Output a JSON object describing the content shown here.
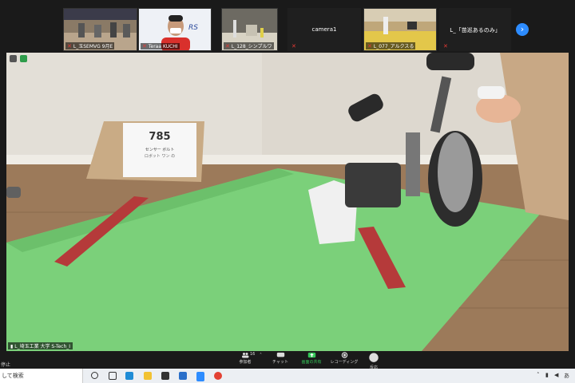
{
  "gallery": {
    "participants": [
      {
        "label": "L_玉SEMVG 9月E",
        "muted": true
      },
      {
        "label": "Teraa KUCHI",
        "muted": true
      },
      {
        "label": "L_128_シンプルワ",
        "muted": true
      },
      {
        "label": "camera1",
        "muted": true
      },
      {
        "label": "L_077_アルクスる",
        "muted": true
      },
      {
        "label": "L_「苗巡あるのみ」",
        "muted": true
      }
    ],
    "next_icon": "chevron-right-icon"
  },
  "main": {
    "sign_number": "785",
    "sign_line1": "センサー ボルト",
    "sign_line2": "ロボット ワン の",
    "speaker_name": "L_埼玉工業 大学 S-Tech_I"
  },
  "controls": {
    "left_label": "停止",
    "participants_count": "16",
    "participants_label": "参加者",
    "chat_label": "チャット",
    "share_label": "画面の共有",
    "record_label": "レコーディング",
    "reactions_label": "反応",
    "share_color": "#35c759"
  },
  "taskbar": {
    "search_placeholder": "して検索",
    "tray_ime": "あ"
  }
}
